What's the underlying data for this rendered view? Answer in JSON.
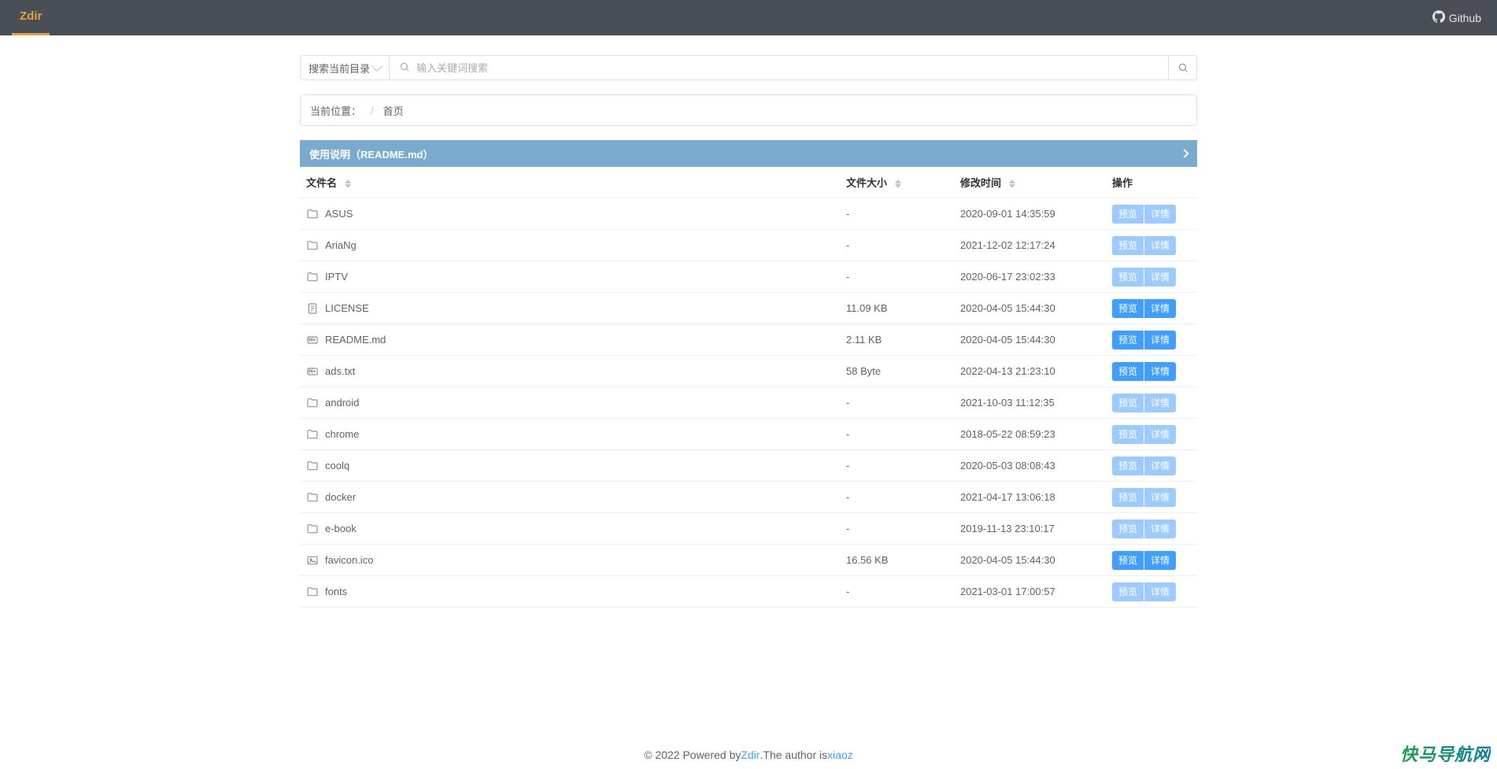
{
  "header": {
    "logo": "Zdir",
    "github_label": "Github"
  },
  "search": {
    "scope_label": "搜索当前目录",
    "placeholder": "输入关键词搜索"
  },
  "breadcrumb": {
    "label": "当前位置：",
    "sep": "/",
    "home": "首页"
  },
  "readme_bar": {
    "label": "使用说明（README.md）"
  },
  "columns": {
    "name": "文件名",
    "size": "文件大小",
    "mtime": "修改时间",
    "ops": "操作"
  },
  "action_labels": {
    "preview": "预览",
    "detail": "详情"
  },
  "files": [
    {
      "type": "folder",
      "name": "ASUS",
      "size": "-",
      "mtime": "2020-09-01 14:35:59",
      "is_file": false
    },
    {
      "type": "folder",
      "name": "AriaNg",
      "size": "-",
      "mtime": "2021-12-02 12:17:24",
      "is_file": false
    },
    {
      "type": "folder",
      "name": "IPTV",
      "size": "-",
      "mtime": "2020-06-17 23:02:33",
      "is_file": false
    },
    {
      "type": "text",
      "name": "LICENSE",
      "size": "11.09 KB",
      "mtime": "2020-04-05 15:44:30",
      "is_file": true
    },
    {
      "type": "markdown",
      "name": "README.md",
      "size": "2.11 KB",
      "mtime": "2020-04-05 15:44:30",
      "is_file": true
    },
    {
      "type": "markdown",
      "name": "ads.txt",
      "size": "58 Byte",
      "mtime": "2022-04-13 21:23:10",
      "is_file": true
    },
    {
      "type": "folder",
      "name": "android",
      "size": "-",
      "mtime": "2021-10-03 11:12:35",
      "is_file": false
    },
    {
      "type": "folder",
      "name": "chrome",
      "size": "-",
      "mtime": "2018-05-22 08:59:23",
      "is_file": false
    },
    {
      "type": "folder",
      "name": "coolq",
      "size": "-",
      "mtime": "2020-05-03 08:08:43",
      "is_file": false
    },
    {
      "type": "folder",
      "name": "docker",
      "size": "-",
      "mtime": "2021-04-17 13:06:18",
      "is_file": false
    },
    {
      "type": "folder",
      "name": "e-book",
      "size": "-",
      "mtime": "2019-11-13 23:10:17",
      "is_file": false
    },
    {
      "type": "image",
      "name": "favicon.ico",
      "size": "16.56 KB",
      "mtime": "2020-04-05 15:44:30",
      "is_file": true
    },
    {
      "type": "folder",
      "name": "fonts",
      "size": "-",
      "mtime": "2021-03-01 17:00:57",
      "is_file": false
    }
  ],
  "footer": {
    "prefix": "© 2022 Powered by ",
    "link1": "Zdir",
    "mid": ".The author is ",
    "link2": "xiaoz"
  },
  "watermark": "快马导航网",
  "icons": {
    "folder": "folder-icon",
    "text": "file-text-icon",
    "markdown": "markdown-icon",
    "image": "image-icon"
  }
}
